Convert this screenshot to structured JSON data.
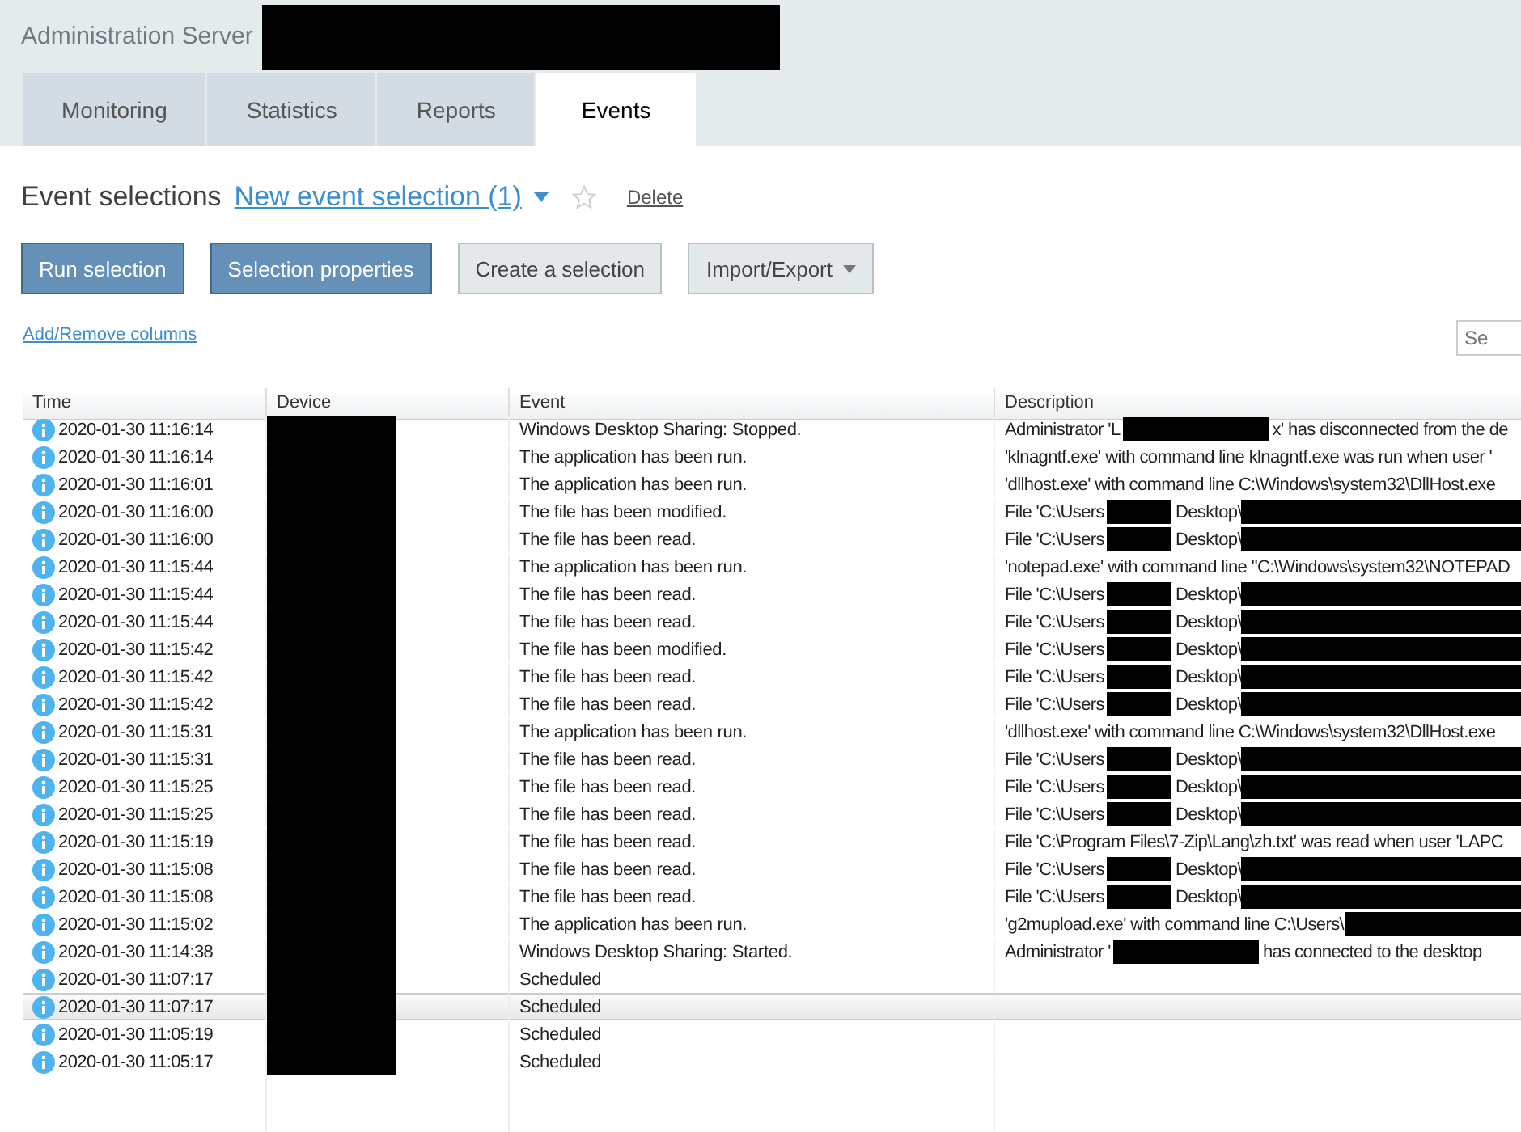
{
  "window": {
    "title": "Administration Server",
    "title_redacted": true
  },
  "tabs": [
    {
      "label": "Monitoring",
      "selected": false
    },
    {
      "label": "Statistics",
      "selected": false
    },
    {
      "label": "Reports",
      "selected": false
    },
    {
      "label": "Events",
      "selected": true
    }
  ],
  "selection_bar": {
    "label": "Event selections",
    "current": "New event selection (1)",
    "favorite": false,
    "delete": "Delete"
  },
  "buttons": [
    {
      "label": "Run selection",
      "kind": "primary"
    },
    {
      "label": "Selection properties",
      "kind": "primary"
    },
    {
      "label": "Create a selection",
      "kind": "secondary"
    },
    {
      "label": "Import/Export",
      "kind": "menu"
    }
  ],
  "columns_link": "Add/Remove columns",
  "search": {
    "placeholder": "Se"
  },
  "table": {
    "columns": [
      "Time",
      "Device",
      "Event",
      "Description"
    ],
    "rows": [
      {
        "time": "2020-01-30 11:16:14",
        "device_redacted": true,
        "event": "Windows Desktop Sharing: Stopped.",
        "description": [
          {
            "text": "Administrator 'L"
          },
          {
            "kind": "redacted"
          },
          {
            "text": "x' has disconnected from the de"
          }
        ],
        "selected": false
      },
      {
        "time": "2020-01-30 11:16:14",
        "device_redacted": true,
        "event": "The application has been run.",
        "description": [
          {
            "text": "'klnagntf.exe' with command line klnagntf.exe was run when user '"
          }
        ],
        "selected": false
      },
      {
        "time": "2020-01-30 11:16:01",
        "device_redacted": true,
        "event": "The application has been run.",
        "description": [
          {
            "text": "'dllhost.exe' with command line C:\\Windows\\system32\\DllHost.exe"
          }
        ],
        "selected": false
      },
      {
        "time": "2020-01-30 11:16:00",
        "device_redacted": true,
        "event": "The file has been modified.",
        "description": [
          {
            "text": "File 'C:\\Users"
          },
          {
            "kind": "redacted"
          },
          {
            "text": "Desktop\\"
          },
          {
            "kind": "redacted"
          }
        ],
        "selected": false
      },
      {
        "time": "2020-01-30 11:16:00",
        "device_redacted": true,
        "event": "The file has been read.",
        "description": [
          {
            "text": "File 'C:\\Users"
          },
          {
            "kind": "redacted"
          },
          {
            "text": "Desktop\\"
          },
          {
            "kind": "redacted"
          }
        ],
        "selected": false
      },
      {
        "time": "2020-01-30 11:15:44",
        "device_redacted": true,
        "event": "The application has been run.",
        "description": [
          {
            "text": "'notepad.exe' with command line \"C:\\Windows\\system32\\NOTEPAD"
          }
        ],
        "selected": false
      },
      {
        "time": "2020-01-30 11:15:44",
        "device_redacted": true,
        "event": "The file has been read.",
        "description": [
          {
            "text": "File 'C:\\Users"
          },
          {
            "kind": "redacted"
          },
          {
            "text": "Desktop\\"
          },
          {
            "kind": "redacted"
          }
        ],
        "selected": false
      },
      {
        "time": "2020-01-30 11:15:44",
        "device_redacted": true,
        "event": "The file has been read.",
        "description": [
          {
            "text": "File 'C:\\Users"
          },
          {
            "kind": "redacted"
          },
          {
            "text": "Desktop\\"
          },
          {
            "kind": "redacted"
          }
        ],
        "selected": false
      },
      {
        "time": "2020-01-30 11:15:42",
        "device_redacted": true,
        "event": "The file has been modified.",
        "description": [
          {
            "text": "File 'C:\\Users"
          },
          {
            "kind": "redacted"
          },
          {
            "text": "Desktop\\"
          },
          {
            "kind": "redacted"
          }
        ],
        "selected": false
      },
      {
        "time": "2020-01-30 11:15:42",
        "device_redacted": true,
        "event": "The file has been read.",
        "description": [
          {
            "text": "File 'C:\\Users"
          },
          {
            "kind": "redacted"
          },
          {
            "text": "Desktop\\"
          },
          {
            "kind": "redacted"
          }
        ],
        "selected": false
      },
      {
        "time": "2020-01-30 11:15:42",
        "device_redacted": true,
        "event": "The file has been read.",
        "description": [
          {
            "text": "File 'C:\\Users"
          },
          {
            "kind": "redacted"
          },
          {
            "text": "Desktop\\"
          },
          {
            "kind": "redacted"
          }
        ],
        "selected": false
      },
      {
        "time": "2020-01-30 11:15:31",
        "device_redacted": true,
        "event": "The application has been run.",
        "description": [
          {
            "text": "'dllhost.exe' with command line C:\\Windows\\system32\\DllHost.exe"
          }
        ],
        "selected": false
      },
      {
        "time": "2020-01-30 11:15:31",
        "device_redacted": true,
        "event": "The file has been read.",
        "description": [
          {
            "text": "File 'C:\\Users"
          },
          {
            "kind": "redacted"
          },
          {
            "text": "Desktop\\"
          },
          {
            "kind": "redacted"
          }
        ],
        "selected": false
      },
      {
        "time": "2020-01-30 11:15:25",
        "device_redacted": true,
        "event": "The file has been read.",
        "description": [
          {
            "text": "File 'C:\\Users"
          },
          {
            "kind": "redacted"
          },
          {
            "text": "Desktop\\"
          },
          {
            "kind": "redacted"
          }
        ],
        "selected": false
      },
      {
        "time": "2020-01-30 11:15:25",
        "device_redacted": true,
        "event": "The file has been read.",
        "description": [
          {
            "text": "File 'C:\\Users"
          },
          {
            "kind": "redacted"
          },
          {
            "text": "Desktop\\"
          },
          {
            "kind": "redacted"
          }
        ],
        "selected": false
      },
      {
        "time": "2020-01-30 11:15:19",
        "device_redacted": true,
        "event": "The file has been read.",
        "description": [
          {
            "text": "File 'C:\\Program Files\\7-Zip\\Lang\\zh.txt' was read when user 'LAPC"
          }
        ],
        "selected": false
      },
      {
        "time": "2020-01-30 11:15:08",
        "device_redacted": true,
        "event": "The file has been read.",
        "description": [
          {
            "text": "File 'C:\\Users"
          },
          {
            "kind": "redacted"
          },
          {
            "text": "Desktop\\"
          },
          {
            "kind": "redacted"
          }
        ],
        "selected": false
      },
      {
        "time": "2020-01-30 11:15:08",
        "device_redacted": true,
        "event": "The file has been read.",
        "description": [
          {
            "text": "File 'C:\\Users"
          },
          {
            "kind": "redacted"
          },
          {
            "text": "Desktop\\"
          },
          {
            "kind": "redacted"
          }
        ],
        "selected": false
      },
      {
        "time": "2020-01-30 11:15:02",
        "device_redacted": true,
        "event": "The application has been run.",
        "description": [
          {
            "text": "'g2mupload.exe' with command line C:\\Users\\"
          },
          {
            "kind": "redacted"
          }
        ],
        "selected": false
      },
      {
        "time": "2020-01-30 11:14:38",
        "device_redacted": true,
        "event": "Windows Desktop Sharing: Started.",
        "description": [
          {
            "text": "Administrator '"
          },
          {
            "kind": "redacted"
          },
          {
            "text": "has connected to the desktop"
          }
        ],
        "selected": false
      },
      {
        "time": "2020-01-30 11:07:17",
        "device_redacted": true,
        "event": "Scheduled",
        "selected": false
      },
      {
        "time": "2020-01-30 11:07:17",
        "device_redacted": true,
        "event": "Scheduled",
        "selected": true
      },
      {
        "time": "2020-01-30 11:05:19",
        "device_redacted": true,
        "event": "Scheduled",
        "selected": false
      },
      {
        "time": "2020-01-30 11:05:17",
        "device_redacted": true,
        "event": "Scheduled",
        "selected": false
      }
    ]
  }
}
